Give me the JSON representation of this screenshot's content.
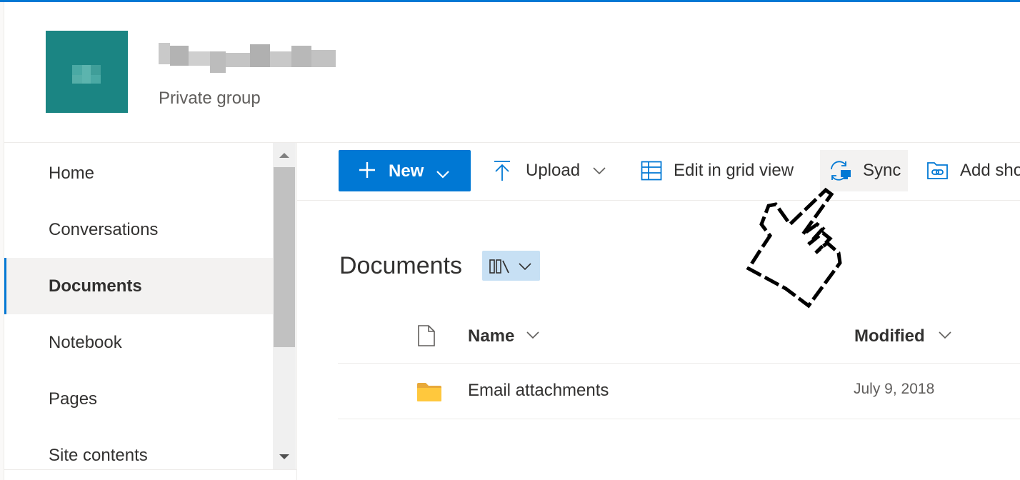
{
  "site": {
    "subtitle": "Private group",
    "accent_color": "#0078d4",
    "logo_color": "#1b8583"
  },
  "nav": {
    "items": [
      {
        "label": "Home",
        "selected": false
      },
      {
        "label": "Conversations",
        "selected": false
      },
      {
        "label": "Documents",
        "selected": true
      },
      {
        "label": "Notebook",
        "selected": false
      },
      {
        "label": "Pages",
        "selected": false
      },
      {
        "label": "Site contents",
        "selected": false
      }
    ]
  },
  "commandbar": {
    "new_label": "New",
    "upload_label": "Upload",
    "grid_label": "Edit in grid view",
    "sync_label": "Sync",
    "shortcut_label": "Add sho"
  },
  "library": {
    "title": "Documents",
    "columns": {
      "name": "Name",
      "modified": "Modified"
    },
    "rows": [
      {
        "name": "Email attachments",
        "modified": "July 9, 2018",
        "type": "folder"
      }
    ]
  },
  "icons": {
    "plus": "plus-icon",
    "chevron": "chevron-down-icon",
    "upload": "upload-arrow-icon",
    "grid": "grid-table-icon",
    "sync": "sync-icon",
    "shortcut": "add-shortcut-icon",
    "library_view": "library-view-icon",
    "file": "file-icon",
    "folder": "folder-icon",
    "cursor": "hand-pointer-cursor"
  }
}
